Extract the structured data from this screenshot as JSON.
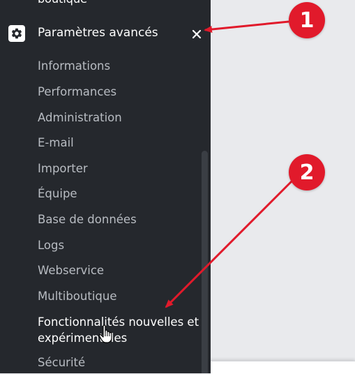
{
  "sidebar": {
    "cutoff_label": "boutique",
    "section": {
      "title": "Paramètres avancés",
      "icon": "gear-icon",
      "collapse_icon": "close-icon"
    },
    "items": [
      {
        "label": "Informations"
      },
      {
        "label": "Performances"
      },
      {
        "label": "Administration"
      },
      {
        "label": "E-mail"
      },
      {
        "label": "Importer"
      },
      {
        "label": "Équipe"
      },
      {
        "label": "Base de données"
      },
      {
        "label": "Logs"
      },
      {
        "label": "Webservice"
      },
      {
        "label": "Multiboutique"
      },
      {
        "label": "Fonctionnalités nouvelles et expérimentales"
      },
      {
        "label": "Sécurité"
      }
    ]
  },
  "annotations": {
    "badge_1": "1",
    "badge_2": "2",
    "color": "#e11a2b"
  }
}
